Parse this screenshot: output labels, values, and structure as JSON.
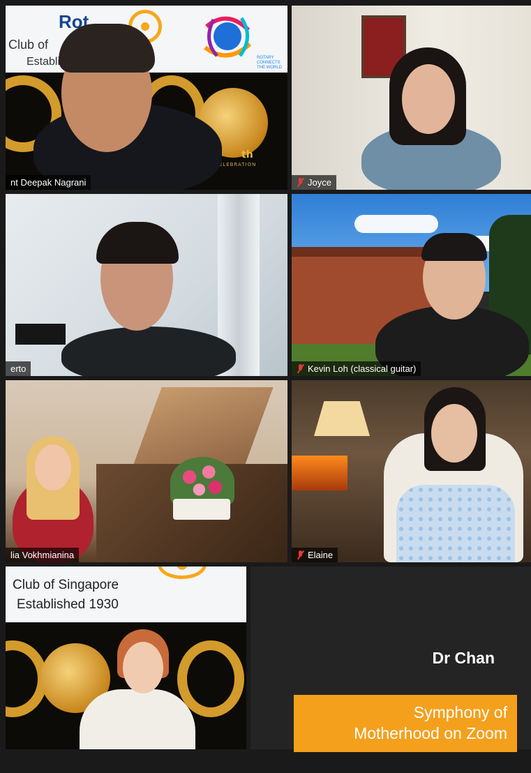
{
  "tiles": [
    {
      "name": "nt Deepak Nagrani",
      "banner": {
        "title": "Rot",
        "club": "Club of",
        "established": "Establi",
        "tagline": "ROTARY CONNECTS THE WORLD",
        "ordinal_suffix": "th",
        "celebration": "CELEBRATION"
      }
    },
    {
      "name": "Joyce"
    },
    {
      "name": "erto"
    },
    {
      "name": "Kevin Loh (classical guitar)"
    },
    {
      "name": "lia Vokhmianina"
    },
    {
      "name": "Elaine"
    },
    {
      "banner": {
        "club": "Club of Singapore",
        "established": "Established 1930"
      }
    },
    {
      "name": "Dr Chan"
    }
  ],
  "caption": {
    "line1": "Symphony of",
    "line2": "Motherhood on Zoom"
  },
  "colors": {
    "active_speaker_border": "#d4e157",
    "caption_bg": "#f4a01c",
    "muted_icon": "#e53935",
    "rotary_blue": "#17458f",
    "rotary_gold": "#f7a81b"
  }
}
